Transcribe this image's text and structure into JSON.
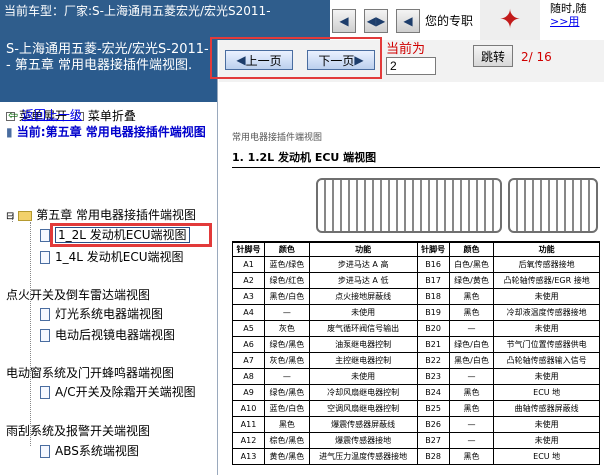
{
  "header": {
    "vehicle_text": "当前车型：厂家:S-上海通用五菱宏光/宏光S2011-",
    "help_text": "您的专职",
    "top_right_line1": "随时,随",
    "top_right_link": ">>用"
  },
  "sidebar": {
    "title": "S-上海通用五菱-宏光/宏光S-2011-- 第五章 常用电器接插件端视图.",
    "expand_label": "菜单展开",
    "collapse_label": "菜单折叠",
    "back_label": "返回上一级",
    "current_label": "当前:第五章 常用电器接插件端视图",
    "tree": [
      {
        "label": "第五章 常用电器接插件端视图",
        "kind": "folder"
      },
      {
        "label": "1_2L 发动机ECU端视图",
        "kind": "doc",
        "selected": true
      },
      {
        "label": "1_4L 发动机ECU端视图",
        "kind": "doc"
      },
      {
        "label": "点火开关及倒车雷达端视图",
        "kind": "section"
      },
      {
        "label": "灯光系统电器端视图",
        "kind": "doc"
      },
      {
        "label": "电动后视镜电器端视图",
        "kind": "doc"
      },
      {
        "label": "电动窗系统及门开蜂鸣器端视图",
        "kind": "section"
      },
      {
        "label": "A/C开关及除霜开关端视图",
        "kind": "doc"
      },
      {
        "label": "雨刮系统及报警开关端视图",
        "kind": "section"
      },
      {
        "label": "ABS系统端视图",
        "kind": "doc"
      }
    ]
  },
  "pager": {
    "prev_label": "上一页",
    "next_label": "下一页",
    "current_label": "当前为",
    "current_value": "2",
    "jump_label": "跳转",
    "page_count": "2/ 16"
  },
  "document": {
    "subtitle": "常用电器接插件端视图",
    "title": "1. 1.2L 发动机 ECU 端视图",
    "columns": [
      "针脚号",
      "颜色",
      "功能",
      "针脚号",
      "颜色",
      "功能"
    ],
    "rows": [
      [
        "A1",
        "蓝色/绿色",
        "步进马达 A 高",
        "B16",
        "白色/黑色",
        "后氧传感器接地"
      ],
      [
        "A2",
        "绿色/红色",
        "步进马达 A 低",
        "B17",
        "绿色/黄色",
        "凸轮轴传感器/EGR 接地"
      ],
      [
        "A3",
        "黑色/白色",
        "点火接地屏蔽线",
        "B18",
        "黑色",
        "未使用"
      ],
      [
        "A4",
        "—",
        "未使用",
        "B19",
        "黑色",
        "冷却液温度传感器接地"
      ],
      [
        "A5",
        "灰色",
        "废气循环阀信号输出",
        "B20",
        "—",
        "未使用"
      ],
      [
        "A6",
        "绿色/黑色",
        "油泵继电器控制",
        "B21",
        "绿色/白色",
        "节气门位置传感器供电"
      ],
      [
        "A7",
        "灰色/黑色",
        "主控继电器控制",
        "B22",
        "黑色/白色",
        "凸轮轴传感器输入信号"
      ],
      [
        "A8",
        "—",
        "未使用",
        "B23",
        "—",
        "未使用"
      ],
      [
        "A9",
        "绿色/黑色",
        "冷却风扇继电器控制",
        "B24",
        "黑色",
        "ECU 地"
      ],
      [
        "A10",
        "蓝色/白色",
        "空调风扇继电器控制",
        "B25",
        "黑色",
        "曲轴传感器屏蔽线"
      ],
      [
        "A11",
        "黑色",
        "爆震传感器屏蔽线",
        "B26",
        "—",
        "未使用"
      ],
      [
        "A12",
        "棕色/黑色",
        "爆震传感器接地",
        "B27",
        "—",
        "未使用"
      ],
      [
        "A13",
        "黄色/黑色",
        "进气压力温度传感器接地",
        "B28",
        "黑色",
        "ECU 地"
      ]
    ]
  }
}
